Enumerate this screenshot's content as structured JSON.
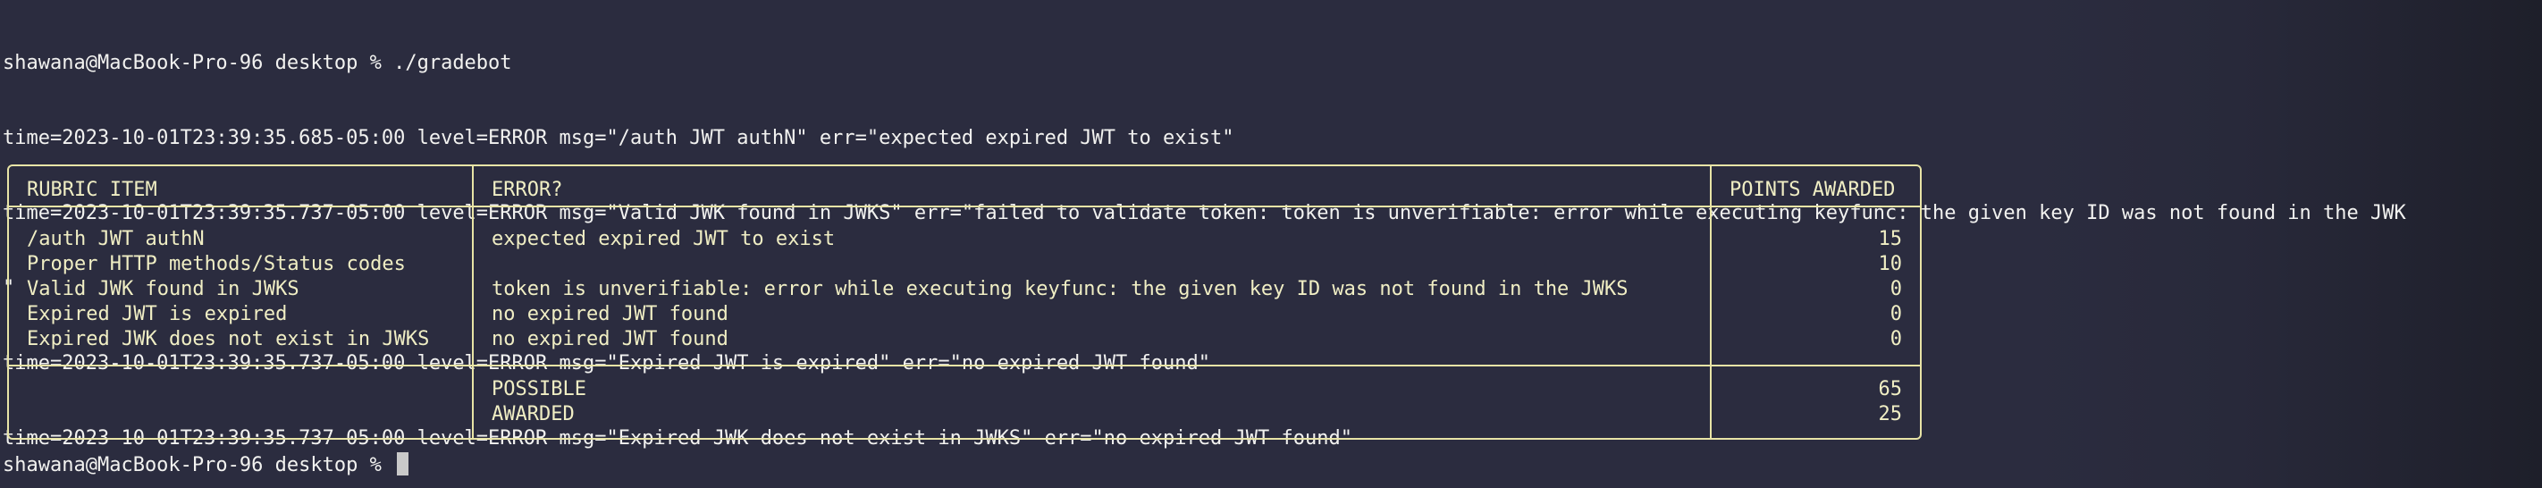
{
  "terminal": {
    "prompt_cmd": "shawana@MacBook-Pro-96 desktop % ./gradebot",
    "log_lines": [
      "time=2023-10-01T23:39:35.685-05:00 level=ERROR msg=\"/auth JWT authN\" err=\"expected expired JWT to exist\"",
      "time=2023-10-01T23:39:35.737-05:00 level=ERROR msg=\"Valid JWK found in JWKS\" err=\"failed to validate token: token is unverifiable: error while executing keyfunc: the given key ID was not found in the JWK",
      "\"",
      "time=2023-10-01T23:39:35.737-05:00 level=ERROR msg=\"Expired JWT is expired\" err=\"no expired JWT found\"",
      "time=2023-10-01T23:39:35.737-05:00 level=ERROR msg=\"Expired JWK does not exist in JWKS\" err=\"no expired JWT found\""
    ],
    "final_prompt": "shawana@MacBook-Pro-96 desktop % "
  },
  "table": {
    "headers": {
      "rubric": "RUBRIC ITEM",
      "error": "ERROR?",
      "points": "POINTS AWARDED"
    },
    "rows": [
      {
        "rubric": "/auth JWT authN",
        "error": "expected expired JWT to exist",
        "points": "15"
      },
      {
        "rubric": "Proper HTTP methods/Status codes",
        "error": "",
        "points": "10"
      },
      {
        "rubric": "Valid JWK found in JWKS",
        "error": "token is unverifiable: error while executing keyfunc: the given key ID was not found in the JWKS",
        "points": "0"
      },
      {
        "rubric": "Expired JWT is expired",
        "error": "no expired JWT found",
        "points": "0"
      },
      {
        "rubric": "Expired JWK does not exist in JWKS",
        "error": "no expired JWT found",
        "points": "0"
      }
    ],
    "footer": [
      {
        "label": "POSSIBLE",
        "value": "65"
      },
      {
        "label": "AWARDED",
        "value": "25"
      }
    ]
  },
  "colors": {
    "background": "#2b2c3f",
    "text": "#f2f2f0",
    "table_border": "#e8e4a6",
    "table_text": "#f0eec4"
  }
}
